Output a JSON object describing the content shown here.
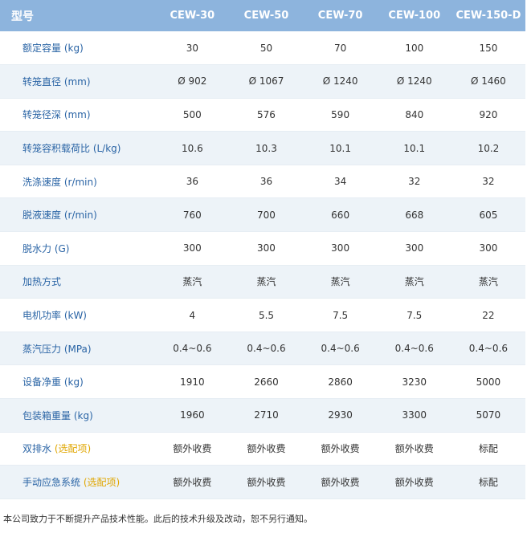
{
  "header": {
    "label": "型号",
    "models": [
      "CEW-30",
      "CEW-50",
      "CEW-70",
      "CEW-100",
      "CEW-150-D"
    ]
  },
  "rows": [
    {
      "label": "额定容量 (kg)",
      "option": "",
      "values": [
        "30",
        "50",
        "70",
        "100",
        "150"
      ]
    },
    {
      "label": "转笼直径 (mm)",
      "option": "",
      "values": [
        "Ø 902",
        "Ø 1067",
        "Ø 1240",
        "Ø 1240",
        "Ø 1460"
      ]
    },
    {
      "label": "转笼径深 (mm)",
      "option": "",
      "values": [
        "500",
        "576",
        "590",
        "840",
        "920"
      ]
    },
    {
      "label": "转笼容积载荷比 (L/kg)",
      "option": "",
      "values": [
        "10.6",
        "10.3",
        "10.1",
        "10.1",
        "10.2"
      ]
    },
    {
      "label": "洗涤速度 (r/min)",
      "option": "",
      "values": [
        "36",
        "36",
        "34",
        "32",
        "32"
      ]
    },
    {
      "label": "脱液速度 (r/min)",
      "option": "",
      "values": [
        "760",
        "700",
        "660",
        "668",
        "605"
      ]
    },
    {
      "label": "脱水力 (G)",
      "option": "",
      "values": [
        "300",
        "300",
        "300",
        "300",
        "300"
      ]
    },
    {
      "label": "加热方式",
      "option": "",
      "values": [
        "蒸汽",
        "蒸汽",
        "蒸汽",
        "蒸汽",
        "蒸汽"
      ]
    },
    {
      "label": "电机功率 (kW)",
      "option": "",
      "values": [
        "4",
        "5.5",
        "7.5",
        "7.5",
        "22"
      ]
    },
    {
      "label": "蒸汽压力 (MPa)",
      "option": "",
      "values": [
        "0.4~0.6",
        "0.4~0.6",
        "0.4~0.6",
        "0.4~0.6",
        "0.4~0.6"
      ]
    },
    {
      "label": "设备净重 (kg)",
      "option": "",
      "values": [
        "1910",
        "2660",
        "2860",
        "3230",
        "5000"
      ]
    },
    {
      "label": "包装箱重量 (kg)",
      "option": "",
      "values": [
        "1960",
        "2710",
        "2930",
        "3300",
        "5070"
      ]
    },
    {
      "label": "双排水 ",
      "option": "(选配项)",
      "values": [
        "额外收费",
        "额外收费",
        "额外收费",
        "额外收费",
        "标配"
      ]
    },
    {
      "label": "手动应急系统 ",
      "option": "(选配项)",
      "values": [
        "额外收费",
        "额外收费",
        "额外收费",
        "额外收费",
        "标配"
      ]
    }
  ],
  "footnote": "本公司致力于不断提升产品技术性能。此后的技术升级及改动，恕不另行通知。",
  "colors": {
    "header_bg": "#8db4dd",
    "label_text": "#2a64a5",
    "option_text": "#e0a600",
    "stripe_bg": "#edf3f8"
  }
}
